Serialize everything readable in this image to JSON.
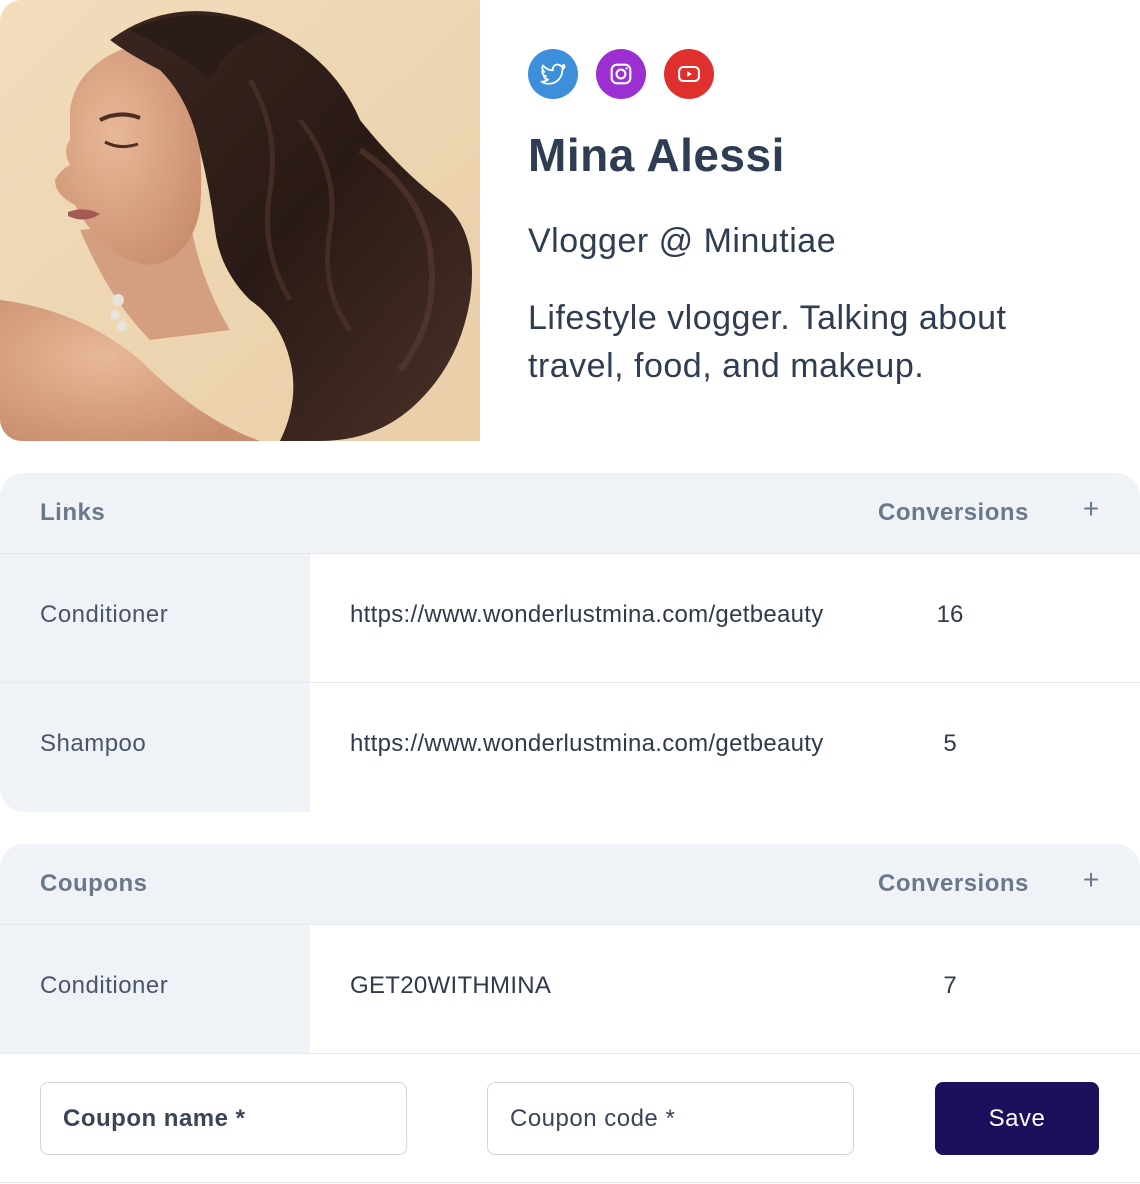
{
  "profile": {
    "name": "Mina Alessi",
    "role": "Vlogger @ Minutiae",
    "bio": "Lifestyle vlogger. Talking about travel, food, and makeup.",
    "socials": [
      {
        "icon": "twitter-icon",
        "color": "#3d8fdc"
      },
      {
        "icon": "instagram-icon",
        "color": "#9b2fd1"
      },
      {
        "icon": "youtube-icon",
        "color": "#e0302d"
      }
    ]
  },
  "links": {
    "title": "Links",
    "conversions_label": "Conversions",
    "add_label": "+",
    "rows": [
      {
        "label": "Conditioner",
        "value": "https://www.wonderlustmina.com/getbeauty",
        "count": "16"
      },
      {
        "label": "Shampoo",
        "value": "https://www.wonderlustmina.com/getbeauty",
        "count": "5"
      }
    ]
  },
  "coupons": {
    "title": "Coupons",
    "conversions_label": "Conversions",
    "add_label": "+",
    "rows": [
      {
        "label": "Conditioner",
        "value": "GET20WITHMINA",
        "count": "7"
      }
    ]
  },
  "form": {
    "coupon_name_placeholder": "Coupon name *",
    "coupon_code_placeholder": "Coupon code *",
    "save_label": "Save"
  },
  "colors": {
    "header_bg": "#eff3f8",
    "save_button": "#1e0f5c",
    "text": "#2f3d52"
  }
}
